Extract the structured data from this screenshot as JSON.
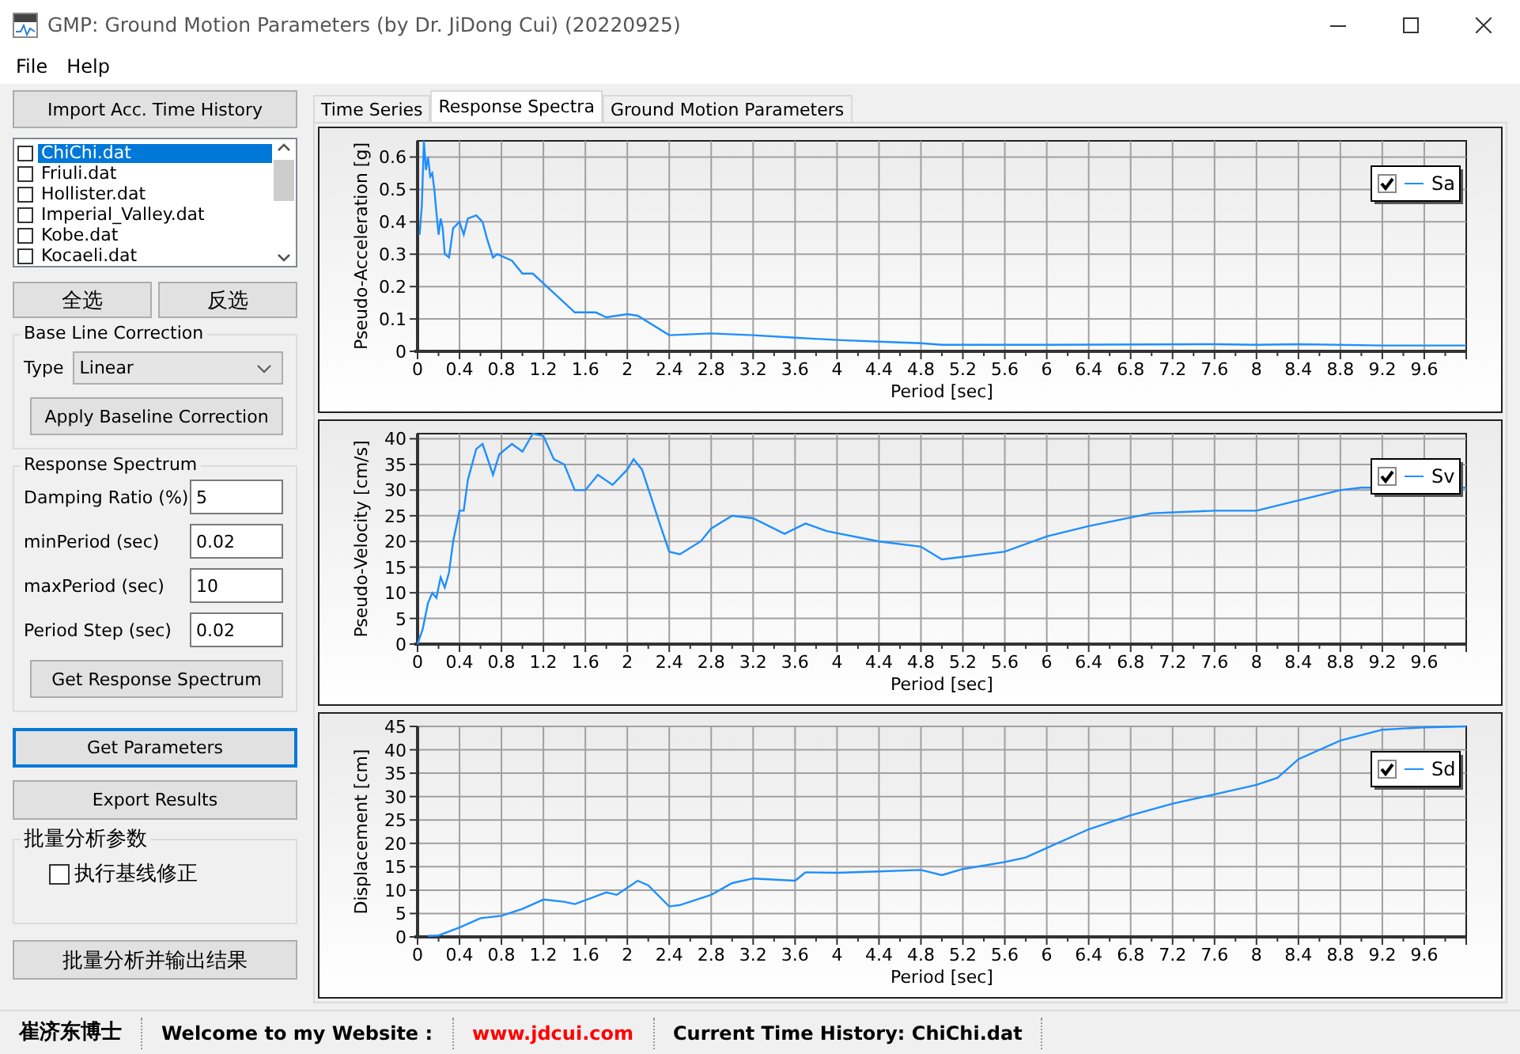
{
  "window": {
    "title": "GMP: Ground Motion Parameters (by Dr. JiDong Cui) (20220925)"
  },
  "menu": [
    "File",
    "Help"
  ],
  "import_button": "Import Acc. Time History",
  "file_list": [
    {
      "name": "ChiChi.dat",
      "checked": false,
      "selected": true
    },
    {
      "name": "Friuli.dat",
      "checked": false,
      "selected": false
    },
    {
      "name": "Hollister.dat",
      "checked": false,
      "selected": false
    },
    {
      "name": "Imperial_Valley.dat",
      "checked": false,
      "selected": false
    },
    {
      "name": "Kobe.dat",
      "checked": false,
      "selected": false
    },
    {
      "name": "Kocaeli.dat",
      "checked": false,
      "selected": false
    }
  ],
  "select_buttons": [
    "全选",
    "反选"
  ],
  "baseline": {
    "title": "Base Line Correction",
    "type_label": "Type",
    "type_value": "Linear",
    "button": "Apply Baseline Correction"
  },
  "response_spectrum": {
    "title": "Response Spectrum",
    "fields": [
      {
        "label": "Damping Ratio (%)",
        "value": "5"
      },
      {
        "label": "minPeriod (sec)",
        "value": "0.02"
      },
      {
        "label": "maxPeriod (sec)",
        "value": "10"
      },
      {
        "label": "Period Step (sec)",
        "value": "0.02"
      }
    ],
    "button": "Get Response Spectrum"
  },
  "action_buttons": [
    {
      "label": "Get Parameters",
      "focused": true
    },
    {
      "label": "Export Results",
      "focused": false
    }
  ],
  "batch": {
    "title": "批量分析参数",
    "checkbox": {
      "label": "执行基线修正",
      "checked": false
    }
  },
  "batch_button": "批量分析并输出结果",
  "tabs": [
    {
      "label": "Time Series",
      "selected": false
    },
    {
      "label": "Response Spectra",
      "selected": true
    },
    {
      "label": "Ground Motion Parameters",
      "selected": false
    }
  ],
  "charts": [
    {
      "legend": {
        "checked": true
      },
      "chart_data": {
        "type": "line",
        "grid": true,
        "xlabel": "Period [sec]",
        "ylabel": "Pseudo-Acceleration [g]",
        "xlim": [
          0,
          10
        ],
        "ylim": [
          0,
          0.65
        ],
        "xticks": [
          0,
          0.4,
          0.8,
          1.2,
          1.6,
          2,
          2.4,
          2.8,
          3.2,
          3.6,
          4,
          4.4,
          4.8,
          5.2,
          5.6,
          6,
          6.4,
          6.8,
          7.2,
          7.6,
          8,
          8.4,
          8.8,
          9.2,
          9.6
        ],
        "yticks": [
          0,
          0.1,
          0.2,
          0.3,
          0.4,
          0.5,
          0.6
        ],
        "x": [
          0.02,
          0.04,
          0.06,
          0.08,
          0.1,
          0.12,
          0.14,
          0.16,
          0.18,
          0.2,
          0.22,
          0.24,
          0.26,
          0.3,
          0.34,
          0.4,
          0.44,
          0.48,
          0.56,
          0.62,
          0.66,
          0.72,
          0.76,
          0.9,
          1.0,
          1.1,
          1.3,
          1.5,
          1.7,
          1.8,
          2.0,
          2.1,
          2.4,
          2.8,
          3.2,
          3.6,
          4.0,
          4.4,
          4.8,
          5.0,
          6.0,
          7.6,
          8.0,
          8.4,
          9.2,
          10
        ],
        "series": [
          {
            "name": "Sa",
            "color": "#1e8fff",
            "values": [
              0.36,
              0.45,
              0.65,
              0.56,
              0.6,
              0.54,
              0.55,
              0.5,
              0.43,
              0.36,
              0.41,
              0.38,
              0.3,
              0.29,
              0.38,
              0.4,
              0.36,
              0.41,
              0.42,
              0.4,
              0.35,
              0.29,
              0.3,
              0.28,
              0.24,
              0.24,
              0.18,
              0.12,
              0.12,
              0.105,
              0.115,
              0.11,
              0.05,
              0.055,
              0.05,
              0.042,
              0.035,
              0.03,
              0.025,
              0.02,
              0.02,
              0.022,
              0.02,
              0.022,
              0.018,
              0.018
            ]
          }
        ]
      }
    },
    {
      "legend": {
        "checked": true
      },
      "chart_data": {
        "type": "line",
        "grid": true,
        "xlabel": "Period [sec]",
        "ylabel": "Pseudo-Velocity [cm/s]",
        "xlim": [
          0,
          10
        ],
        "ylim": [
          0,
          41
        ],
        "xticks": [
          0,
          0.4,
          0.8,
          1.2,
          1.6,
          2,
          2.4,
          2.8,
          3.2,
          3.6,
          4,
          4.4,
          4.8,
          5.2,
          5.6,
          6,
          6.4,
          6.8,
          7.2,
          7.6,
          8,
          8.4,
          8.8,
          9.2,
          9.6
        ],
        "yticks": [
          0,
          5,
          10,
          15,
          20,
          25,
          30,
          35,
          40
        ],
        "x": [
          0,
          0.05,
          0.1,
          0.14,
          0.18,
          0.22,
          0.26,
          0.3,
          0.34,
          0.4,
          0.44,
          0.48,
          0.56,
          0.62,
          0.72,
          0.78,
          0.9,
          1.0,
          1.1,
          1.2,
          1.3,
          1.4,
          1.5,
          1.6,
          1.72,
          1.86,
          2.0,
          2.06,
          2.14,
          2.3,
          2.4,
          2.5,
          2.7,
          2.8,
          3.0,
          3.2,
          3.5,
          3.7,
          3.9,
          4.4,
          4.8,
          5.0,
          5.6,
          6.0,
          6.4,
          7.0,
          7.6,
          8.0,
          8.4,
          8.8,
          9.0,
          10
        ],
        "series": [
          {
            "name": "Sv",
            "color": "#1e8fff",
            "values": [
              0,
              3,
              8,
              10,
              9,
              13,
              11,
              14,
              20,
              26,
              26,
              32,
              38,
              39,
              33,
              37,
              39,
              37.5,
              41,
              40.5,
              36,
              35,
              30,
              30,
              33,
              31,
              34,
              36,
              34,
              24,
              18,
              17.5,
              20,
              22.5,
              25,
              24.5,
              21.5,
              23.5,
              22,
              20,
              19,
              16.5,
              18,
              21,
              23,
              25.5,
              26,
              26,
              28,
              30,
              30.5,
              30.5
            ]
          }
        ]
      }
    },
    {
      "legend": {
        "checked": true
      },
      "chart_data": {
        "type": "line",
        "grid": true,
        "xlabel": "Period [sec]",
        "ylabel": "Displacement [cm]",
        "xlim": [
          0,
          10
        ],
        "ylim": [
          0,
          45
        ],
        "xticks": [
          0,
          0.4,
          0.8,
          1.2,
          1.6,
          2,
          2.4,
          2.8,
          3.2,
          3.6,
          4,
          4.4,
          4.8,
          5.2,
          5.6,
          6,
          6.4,
          6.8,
          7.2,
          7.6,
          8,
          8.4,
          8.8,
          9.2,
          9.6
        ],
        "yticks": [
          0,
          5,
          10,
          15,
          20,
          25,
          30,
          35,
          40,
          45
        ],
        "x": [
          0.1,
          0.2,
          0.4,
          0.6,
          0.8,
          1.0,
          1.2,
          1.4,
          1.5,
          1.8,
          1.9,
          2.1,
          2.2,
          2.4,
          2.5,
          2.8,
          3.0,
          3.2,
          3.6,
          3.7,
          4.0,
          4.4,
          4.8,
          5.0,
          5.2,
          5.6,
          5.8,
          6.0,
          6.4,
          6.8,
          7.2,
          7.6,
          8.0,
          8.2,
          8.4,
          8.8,
          9.2,
          9.6,
          10
        ],
        "series": [
          {
            "name": "Sd",
            "color": "#1e8fff",
            "values": [
              0.2,
              0.3,
              2,
              4,
              4.5,
              6,
              8,
              7.5,
              7,
              9.5,
              9,
              12,
              11,
              6.5,
              6.8,
              9,
              11.5,
              12.5,
              12,
              13.8,
              13.7,
              14,
              14.3,
              13.2,
              14.5,
              16,
              17,
              19,
              23,
              26,
              28.5,
              30.5,
              32.5,
              34,
              38,
              42,
              44.3,
              44.8,
              45
            ]
          }
        ]
      }
    }
  ],
  "status_bar": [
    {
      "text": "崔济东博士",
      "kind": "name"
    },
    {
      "text": "Welcome to my Website :",
      "kind": "label"
    },
    {
      "text": "www.jdcui.com",
      "kind": "link"
    },
    {
      "text": "Current Time History: ChiChi.dat",
      "kind": "info"
    }
  ]
}
